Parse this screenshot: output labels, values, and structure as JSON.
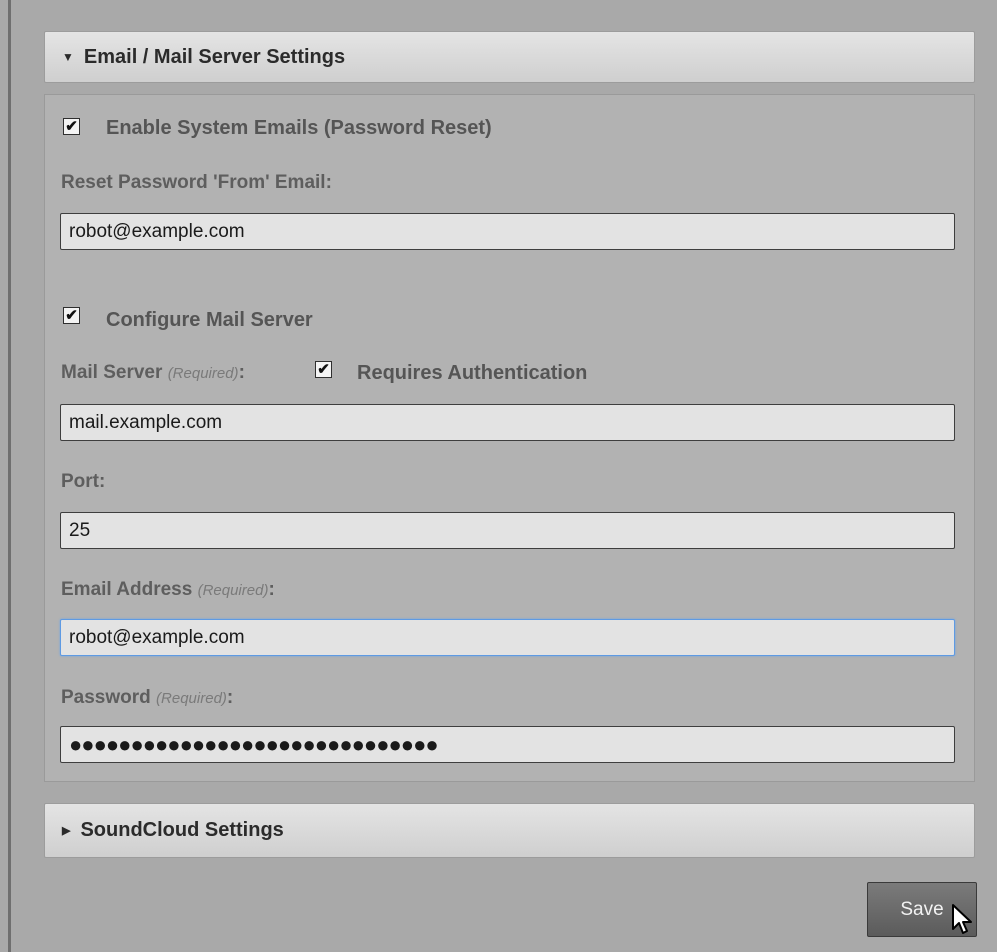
{
  "email_section": {
    "title": "Email / Mail Server Settings",
    "enable_emails_label": "Enable System Emails (Password Reset)",
    "enable_emails_checked": true,
    "reset_from_label": "Reset Password 'From' Email:",
    "reset_from_value": "robot@example.com",
    "configure_server_label": "Configure Mail Server",
    "configure_server_checked": true,
    "mail_server_label": "Mail Server",
    "required_note": "(Required)",
    "colon": ":",
    "requires_auth_label": "Requires Authentication",
    "requires_auth_checked": true,
    "mail_server_value": "mail.example.com",
    "port_label": "Port:",
    "port_value": "25",
    "email_address_label": "Email Address",
    "email_address_value": "robot@example.com",
    "password_label": "Password",
    "password_value": "●●●●●●●●●●●●●●●●●●●●●●●●●●●●●●"
  },
  "soundcloud_section": {
    "title": "SoundCloud Settings"
  },
  "save_button": "Save",
  "icons": {
    "expanded_arrow": "triangle-down",
    "collapsed_arrow": "triangle-right",
    "checkbox_mark": "✔"
  }
}
